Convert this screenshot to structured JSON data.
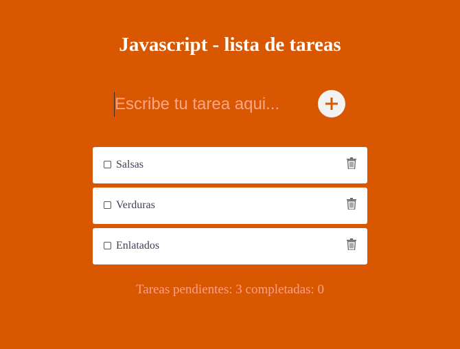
{
  "header": {
    "title": "Javascript - lista de tareas"
  },
  "new_task": {
    "placeholder": "Escribe tu tarea aqui...",
    "value": "",
    "add_icon": "plus-icon"
  },
  "tasks": [
    {
      "label": "Salsas",
      "completed": false,
      "delete_icon": "trash-icon"
    },
    {
      "label": "Verduras",
      "completed": false,
      "delete_icon": "trash-icon"
    },
    {
      "label": "Enlatados",
      "completed": false,
      "delete_icon": "trash-icon"
    }
  ],
  "footer": {
    "status_text": "Tareas pendientes: 3 completadas: 0"
  },
  "colors": {
    "background": "#d95700",
    "accent": "#d95700",
    "card": "#ffffff"
  }
}
